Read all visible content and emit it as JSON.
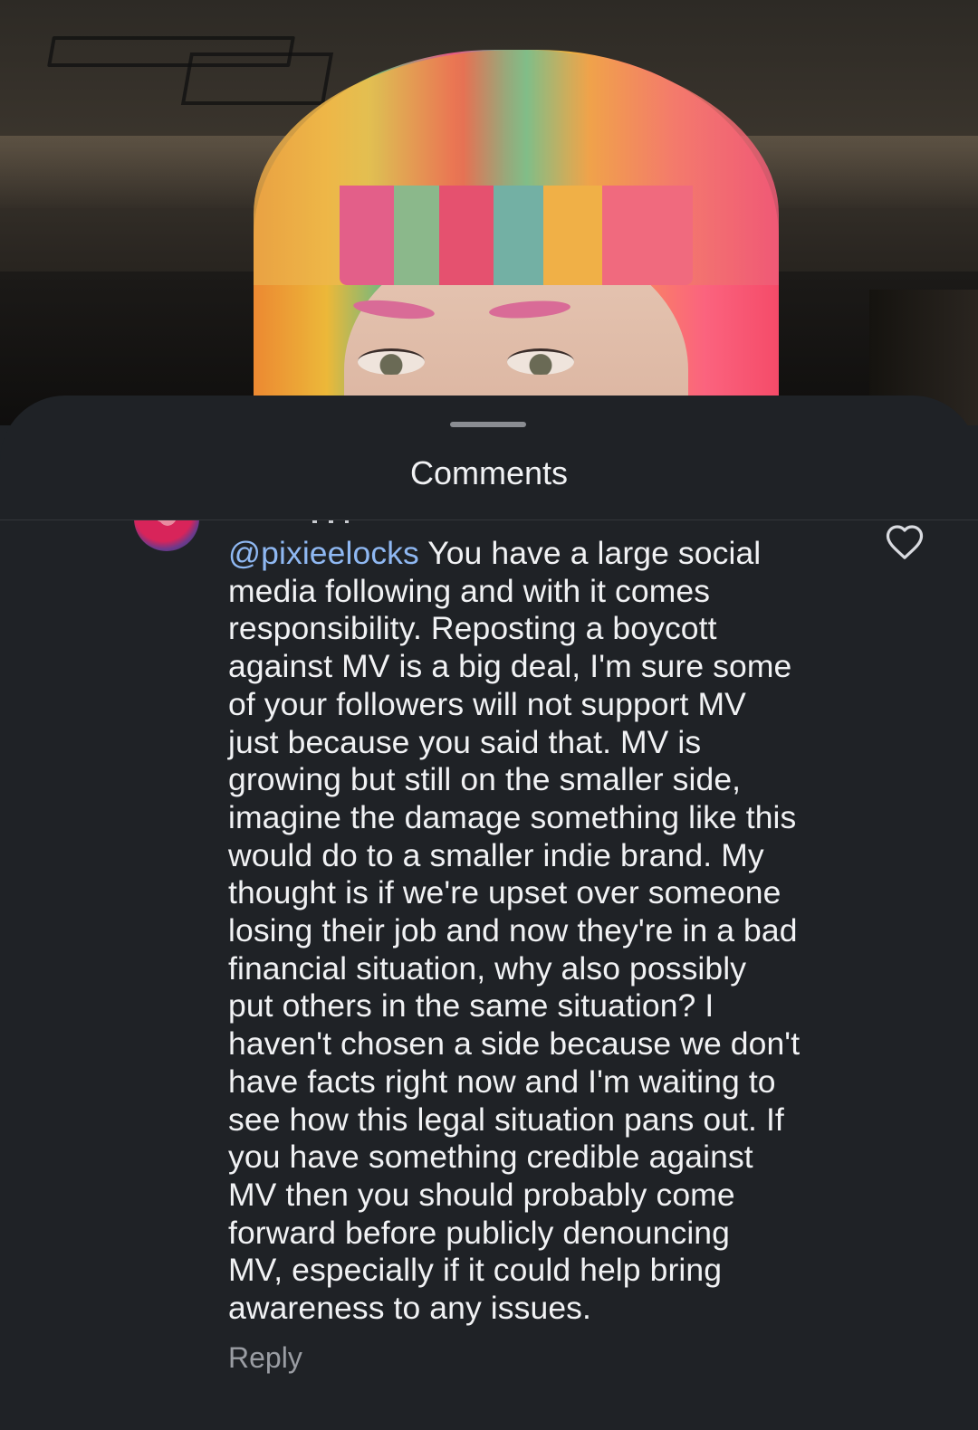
{
  "sheet": {
    "title": "Comments"
  },
  "comment": {
    "mention": "@pixieelocks",
    "lines": [
      " You have a large social",
      "media following and with it comes",
      "responsibility. Reposting a boycott",
      "against MV is a big deal, I'm sure some",
      "of your followers will not support MV",
      "just because you said that. MV is",
      "growing but still on the smaller side,",
      "imagine the damage something like this",
      "would do to a smaller indie brand. My",
      "thought is if we're upset over someone",
      "losing their job and now they're in a bad",
      "financial situation, why also possibly",
      "put others in the same situation? I",
      "haven't chosen a side because we don't",
      "have facts right now and I'm waiting to",
      "see how this legal situation pans out. If",
      "you have something credible against",
      "MV then you should probably come",
      "forward before publicly denouncing",
      "MV, especially if it could help bring",
      "awareness to any issues."
    ],
    "reply_label": "Reply",
    "like_icon": "heart-outline-icon"
  },
  "colors": {
    "sheet_background": "#1f2226",
    "text": "#f1f2f4",
    "mention": "#8fb8f2",
    "muted": "#9a9da3"
  }
}
